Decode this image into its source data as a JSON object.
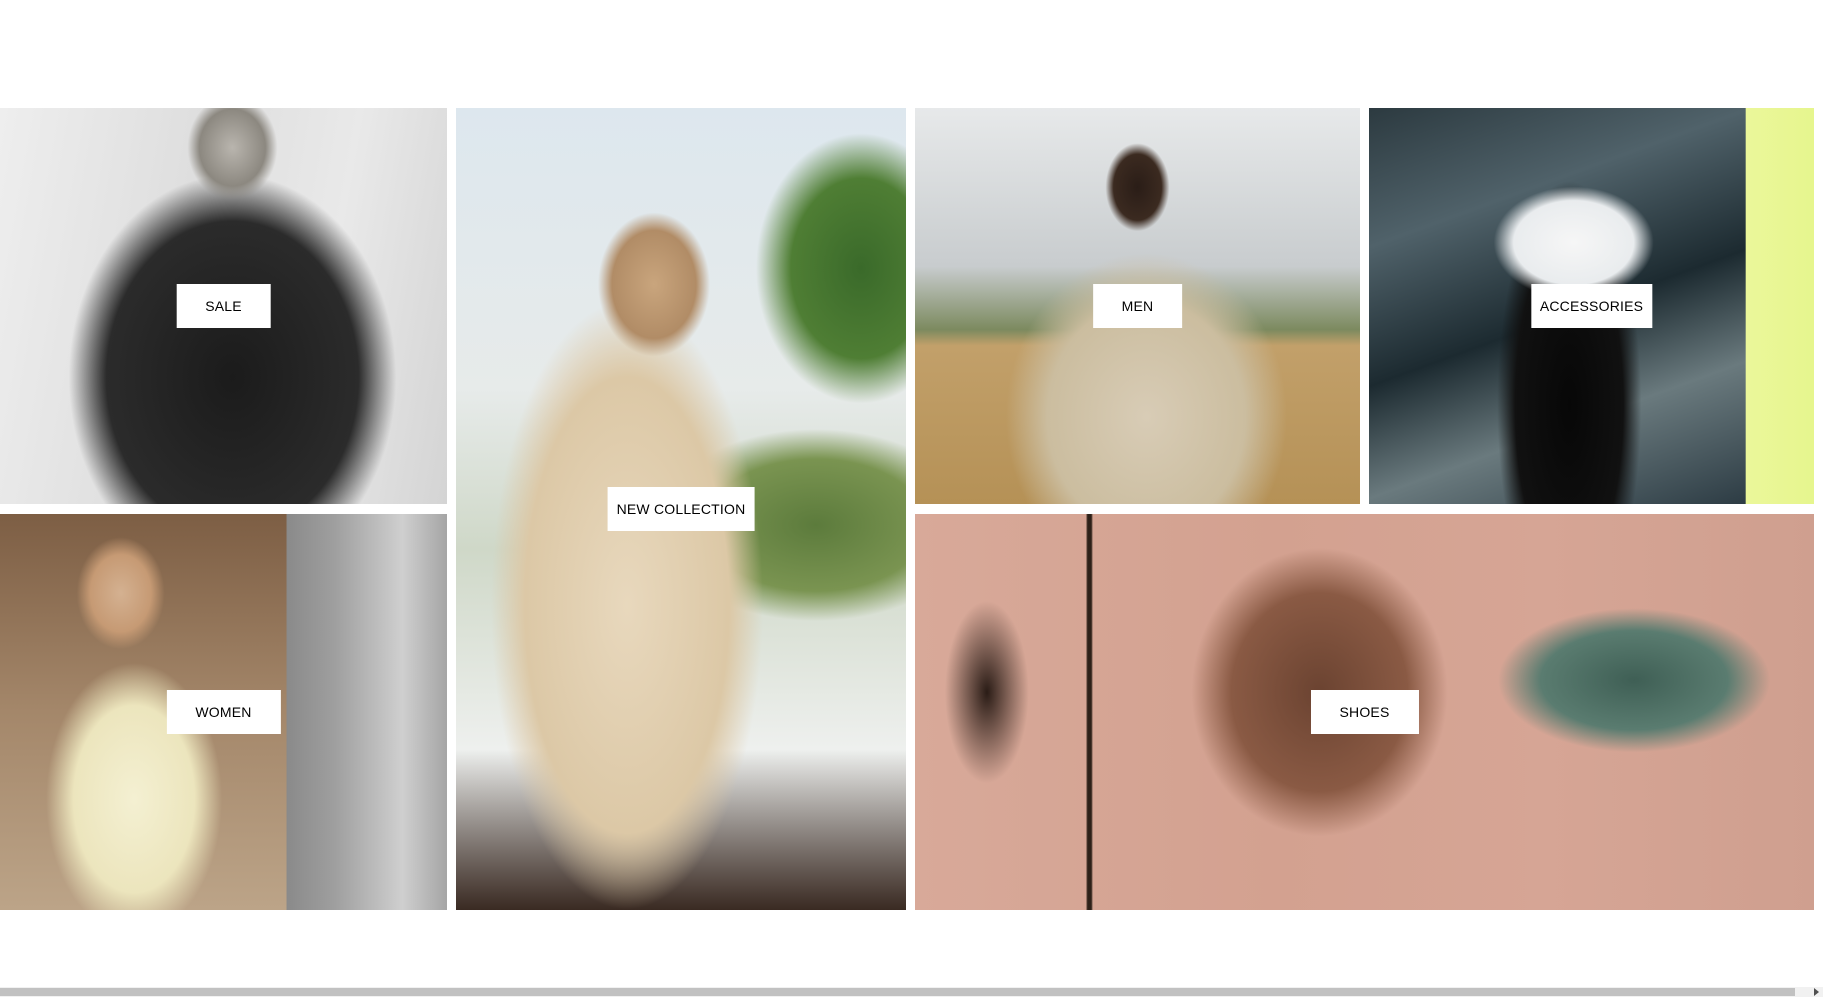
{
  "categories": {
    "sale": {
      "label": "SALE"
    },
    "new_collection": {
      "label": "NEW COLLECTION"
    },
    "men": {
      "label": "MEN"
    },
    "accessories": {
      "label": "ACCESSORIES"
    },
    "women": {
      "label": "WOMEN"
    },
    "shoes": {
      "label": "SHOES"
    }
  },
  "icons": {
    "scroll_right": "triangle-right"
  }
}
